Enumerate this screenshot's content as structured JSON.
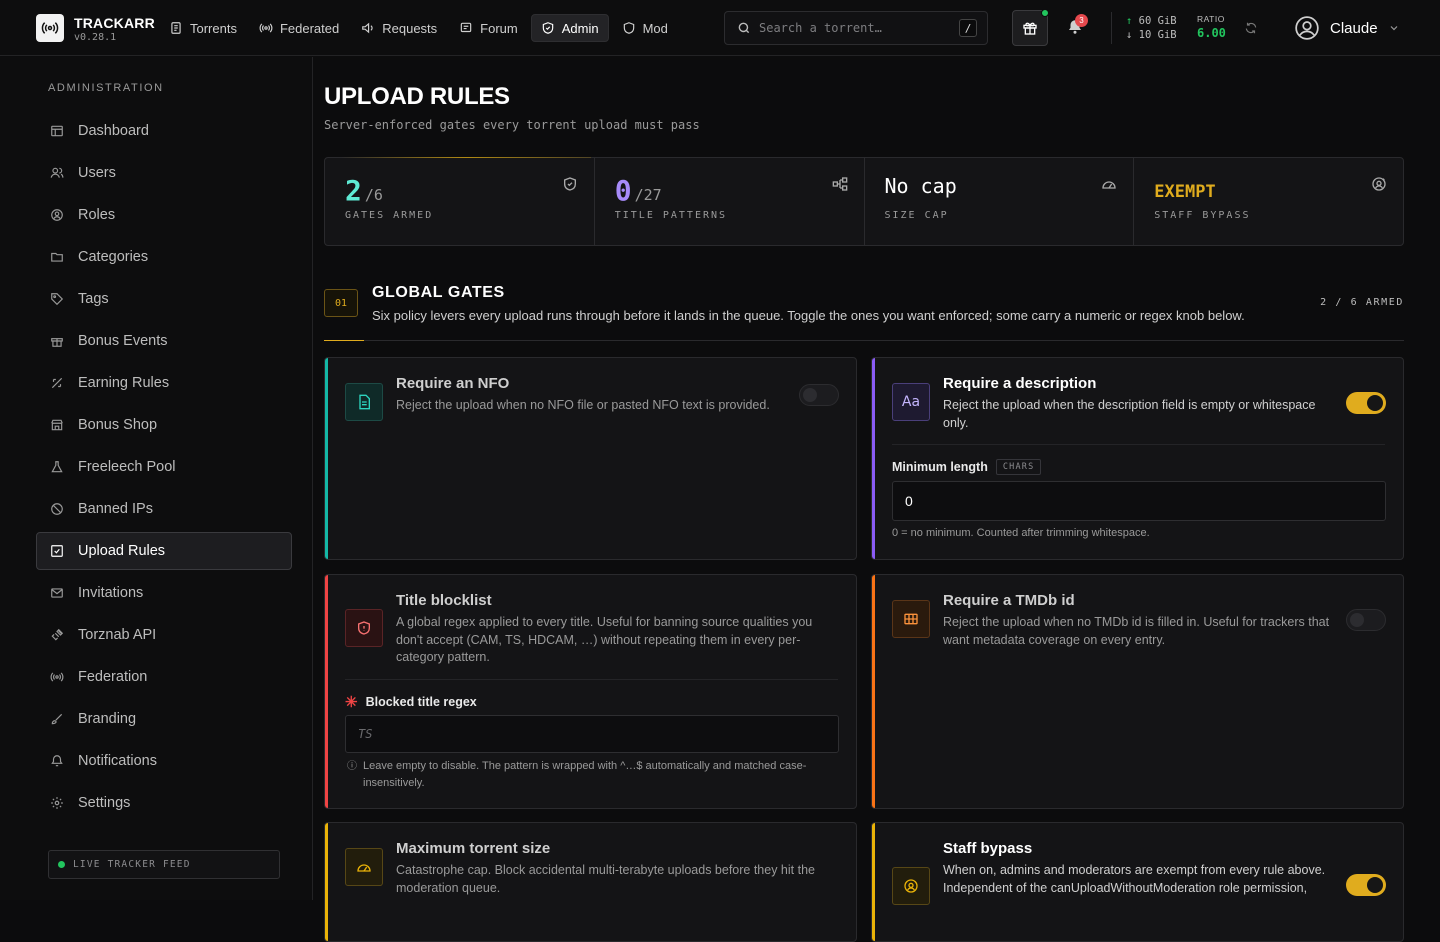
{
  "app": {
    "name": "TRACKARR",
    "version": "v0.28.1"
  },
  "nav": [
    {
      "label": "Torrents",
      "icon": "torrents-icon"
    },
    {
      "label": "Federated",
      "icon": "broadcast-icon"
    },
    {
      "label": "Requests",
      "icon": "megaphone-icon"
    },
    {
      "label": "Forum",
      "icon": "forum-icon"
    },
    {
      "label": "Admin",
      "icon": "shield-check-icon",
      "active": true
    },
    {
      "label": "Mod",
      "icon": "shield-icon"
    }
  ],
  "search": {
    "placeholder": "Search a torrent…",
    "shortcut": "/"
  },
  "notifications": {
    "count": "3"
  },
  "traffic": {
    "up": "60 GiB",
    "down": "10 GiB",
    "ratio_label": "RATIO",
    "ratio": "6.00"
  },
  "user": {
    "name": "Claude"
  },
  "sidebar": {
    "heading": "ADMINISTRATION",
    "items": [
      {
        "label": "Dashboard"
      },
      {
        "label": "Users"
      },
      {
        "label": "Roles"
      },
      {
        "label": "Categories"
      },
      {
        "label": "Tags"
      },
      {
        "label": "Bonus Events"
      },
      {
        "label": "Earning Rules"
      },
      {
        "label": "Bonus Shop"
      },
      {
        "label": "Freeleech Pool"
      },
      {
        "label": "Banned IPs"
      },
      {
        "label": "Upload Rules",
        "active": true
      },
      {
        "label": "Invitations"
      },
      {
        "label": "Torznab API"
      },
      {
        "label": "Federation"
      },
      {
        "label": "Branding"
      },
      {
        "label": "Notifications"
      },
      {
        "label": "Settings"
      }
    ],
    "live": "LIVE TRACKER FEED"
  },
  "page": {
    "title": "UPLOAD RULES",
    "subtitle": "Server-enforced gates every torrent upload must pass"
  },
  "stats": [
    {
      "num": "2",
      "den": "/6",
      "label": "GATES ARMED",
      "color": "#5eead4",
      "icon": "shield-check-icon"
    },
    {
      "num": "0",
      "den": "/27",
      "label": "TITLE PATTERNS",
      "color": "#a78bfa",
      "icon": "hierarchy-icon"
    },
    {
      "num": "No cap",
      "den": "",
      "label": "SIZE CAP",
      "color": "#ffffff",
      "icon": "gauge-icon"
    },
    {
      "num": "EXEMPT",
      "den": "",
      "label": "STAFF BYPASS",
      "color": "#e0ac1e",
      "icon": "user-badge-icon"
    }
  ],
  "section": {
    "num": "01",
    "title": "GLOBAL GATES",
    "desc": "Six policy levers every upload runs through before it lands in the queue. Toggle the ones you want enforced; some carry a numeric or regex knob below.",
    "count": "2 / 6 ARMED"
  },
  "cards": {
    "nfo": {
      "title": "Require an NFO",
      "desc": "Reject the upload when no NFO file or pasted NFO text is provided.",
      "enabled": false,
      "accent": "#14b8a6"
    },
    "description": {
      "title": "Require a description",
      "desc": "Reject the upload when the description field is empty or whitespace only.",
      "enabled": true,
      "accent": "#8b5cf6",
      "field_label": "Minimum length",
      "field_chip": "CHARS",
      "field_value": "0",
      "field_help": "0 = no minimum. Counted after trimming whitespace."
    },
    "blocklist": {
      "title": "Title blocklist",
      "desc": "A global regex applied to every title. Useful for banning source qualities you don't accept (CAM, TS, HDCAM, …) without repeating them in every per-category pattern.",
      "enabled": false,
      "accent": "#ef4444",
      "field_label": "Blocked title regex",
      "field_placeholder": "TS",
      "field_help": "Leave empty to disable. The pattern is wrapped with ^…$ automatically and matched case-insensitively."
    },
    "tmdb": {
      "title": "Require a TMDb id",
      "desc": "Reject the upload when no TMDb id is filled in. Useful for trackers that want metadata coverage on every entry.",
      "enabled": false,
      "accent": "#f97316"
    },
    "maxsize": {
      "title": "Maximum torrent size",
      "desc": "Catastrophe cap. Block accidental multi-terabyte uploads before they hit the moderation queue.",
      "enabled": false,
      "accent": "#eab308"
    },
    "staff": {
      "title": "Staff bypass",
      "desc": "When on, admins and moderators are exempt from every rule above. Independent of the canUploadWithoutModeration role permission,",
      "enabled": true,
      "accent": "#eab308"
    }
  }
}
